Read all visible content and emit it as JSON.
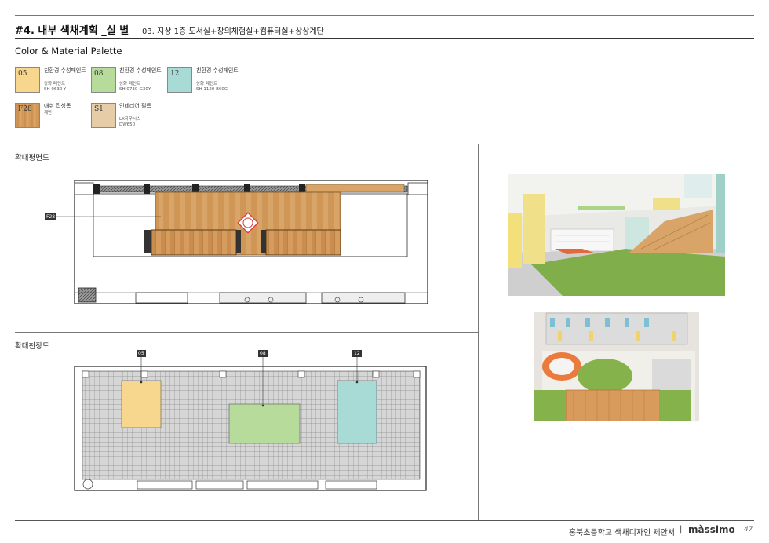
{
  "header": {
    "title": "#4. 내부 색채계획 _실 별",
    "subtitle": "03. 지상 1층 도서실+창의체험실+컴퓨터실+상상계단"
  },
  "palette": {
    "title": "Color & Material Palette",
    "items": [
      {
        "code": "05",
        "name": "친환경 수성페인트",
        "spec1": "상화 페인트",
        "spec2": "SH 0630-Y",
        "color": "#f7d68e"
      },
      {
        "code": "08",
        "name": "친환경 수성페인트",
        "spec1": "상화 페인트",
        "spec2": "SH 0730-G30Y",
        "color": "#b6db9b"
      },
      {
        "code": "12",
        "name": "친환경 수성페인트",
        "spec1": "상화 페인트",
        "spec2": "SH 1120-B60G",
        "color": "#a8dad6"
      },
      {
        "code": "F28",
        "name": "애쉬 집성목",
        "spec1": "계단",
        "spec2": "",
        "color": "#d49a59"
      },
      {
        "code": "S1",
        "name": "인테리어 필름",
        "spec1": "LX하우시스",
        "spec2": "DW650",
        "color": "#e6cda8"
      }
    ]
  },
  "sections": {
    "plan_label": "확대평면도",
    "ceiling_label": "확대천장도"
  },
  "plan": {
    "floor_tag": "F28"
  },
  "ceiling": {
    "tags": [
      "05",
      "08",
      "12"
    ]
  },
  "footer": {
    "doc_title": "홍북초등학교 색채디자인 제안서",
    "separator": "|",
    "brand": "màssimo",
    "page": "47"
  }
}
